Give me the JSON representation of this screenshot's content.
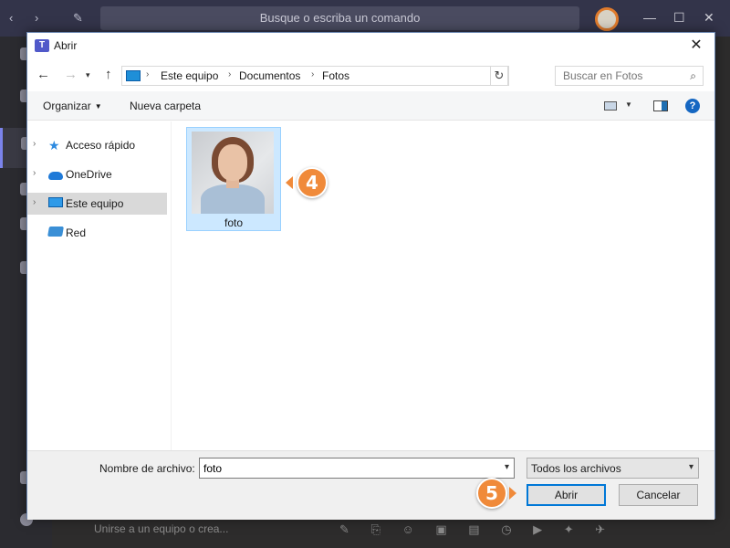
{
  "teams": {
    "search_placeholder": "Busque o escriba un comando",
    "join_text": "Unirse a un equipo o crea..."
  },
  "dialog": {
    "title": "Abrir",
    "breadcrumb": [
      "Este equipo",
      "Documentos",
      "Fotos"
    ],
    "search_placeholder": "Buscar en Fotos",
    "toolbar": {
      "organize_label": "Organizar",
      "new_folder_label": "Nueva carpeta"
    },
    "nav_items": [
      {
        "label": "Acceso rápido",
        "icon": "star-icon",
        "expandable": true
      },
      {
        "label": "OneDrive",
        "icon": "cloud-icon",
        "expandable": true
      },
      {
        "label": "Este equipo",
        "icon": "computer-icon",
        "expandable": true,
        "selected": true
      },
      {
        "label": "Red",
        "icon": "network-icon",
        "expandable": false
      }
    ],
    "files": [
      {
        "name": "foto",
        "type": "image"
      }
    ],
    "filename_label": "Nombre de archivo:",
    "filename_value": "foto",
    "filter_value": "Todos los archivos",
    "open_button": "Abrir",
    "cancel_button": "Cancelar"
  },
  "callouts": [
    {
      "number": "4"
    },
    {
      "number": "5"
    }
  ],
  "colors": {
    "accent_orange": "#f08a3a",
    "selection_blue": "#cce8ff",
    "primary_border": "#0078d7"
  }
}
